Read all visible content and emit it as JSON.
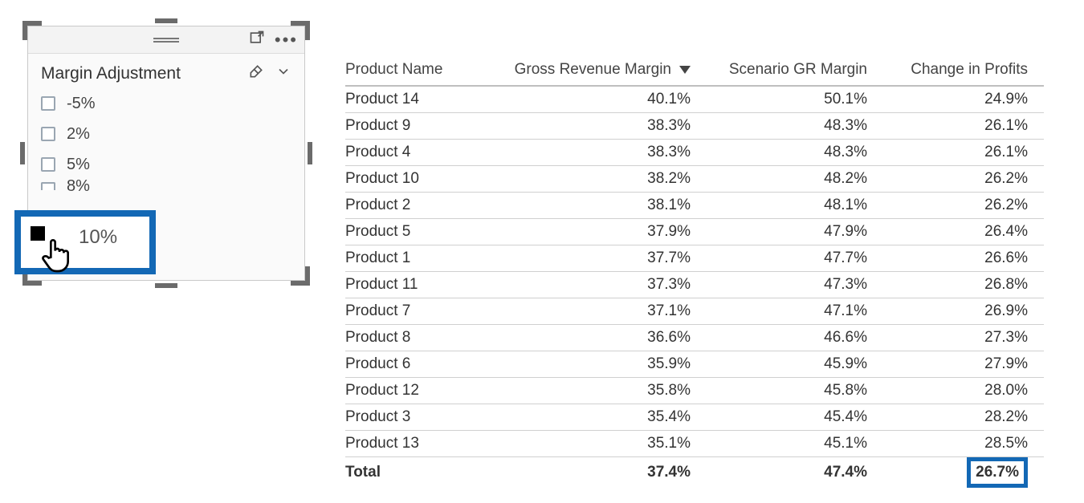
{
  "slicer": {
    "title": "Margin Adjustment",
    "items": [
      {
        "label": "-5%",
        "checked": false
      },
      {
        "label": "2%",
        "checked": false
      },
      {
        "label": "5%",
        "checked": false
      },
      {
        "label": "8%",
        "checked": false
      }
    ],
    "highlighted": {
      "label": "10%",
      "checked": true
    }
  },
  "table": {
    "columns": {
      "c0": "Product Name",
      "c1": "Gross Revenue Margin",
      "c2": "Scenario GR Margin",
      "c3": "Change in Profits"
    },
    "rows": [
      {
        "name": "Product 14",
        "grm": "40.1%",
        "sgr": "50.1%",
        "chg": "24.9%"
      },
      {
        "name": "Product 9",
        "grm": "38.3%",
        "sgr": "48.3%",
        "chg": "26.1%"
      },
      {
        "name": "Product 4",
        "grm": "38.3%",
        "sgr": "48.3%",
        "chg": "26.1%"
      },
      {
        "name": "Product 10",
        "grm": "38.2%",
        "sgr": "48.2%",
        "chg": "26.2%"
      },
      {
        "name": "Product 2",
        "grm": "38.1%",
        "sgr": "48.1%",
        "chg": "26.2%"
      },
      {
        "name": "Product 5",
        "grm": "37.9%",
        "sgr": "47.9%",
        "chg": "26.4%"
      },
      {
        "name": "Product 1",
        "grm": "37.7%",
        "sgr": "47.7%",
        "chg": "26.6%"
      },
      {
        "name": "Product 11",
        "grm": "37.3%",
        "sgr": "47.3%",
        "chg": "26.8%"
      },
      {
        "name": "Product 7",
        "grm": "37.1%",
        "sgr": "47.1%",
        "chg": "26.9%"
      },
      {
        "name": "Product 8",
        "grm": "36.6%",
        "sgr": "46.6%",
        "chg": "27.3%"
      },
      {
        "name": "Product 6",
        "grm": "35.9%",
        "sgr": "45.9%",
        "chg": "27.9%"
      },
      {
        "name": "Product 12",
        "grm": "35.8%",
        "sgr": "45.8%",
        "chg": "28.0%"
      },
      {
        "name": "Product 3",
        "grm": "35.4%",
        "sgr": "45.4%",
        "chg": "28.2%"
      },
      {
        "name": "Product 13",
        "grm": "35.1%",
        "sgr": "45.1%",
        "chg": "28.5%"
      }
    ],
    "total": {
      "label": "Total",
      "grm": "37.4%",
      "sgr": "47.4%",
      "chg": "26.7%"
    }
  }
}
